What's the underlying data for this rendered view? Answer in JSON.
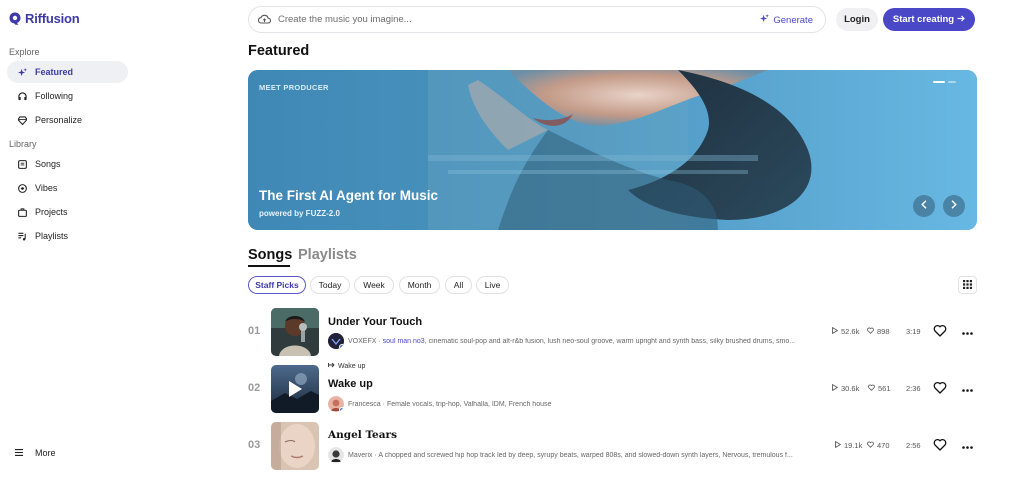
{
  "app": {
    "name": "Riffusion"
  },
  "sidebar": {
    "explore_label": "Explore",
    "library_label": "Library",
    "explore_items": [
      {
        "label": "Featured",
        "icon": "sparkle-icon",
        "active": true
      },
      {
        "label": "Following",
        "icon": "headphones-icon",
        "active": false
      },
      {
        "label": "Personalize",
        "icon": "gem-icon",
        "active": false
      }
    ],
    "library_items": [
      {
        "label": "Songs",
        "icon": "music-box-icon"
      },
      {
        "label": "Vibes",
        "icon": "vibes-icon"
      },
      {
        "label": "Projects",
        "icon": "briefcase-icon"
      },
      {
        "label": "Playlists",
        "icon": "playlist-icon"
      }
    ],
    "more_label": "More"
  },
  "topbar": {
    "search_placeholder": "Create the music you imagine...",
    "generate_label": "Generate",
    "login_label": "Login",
    "start_label": "Start creating"
  },
  "featured": {
    "heading": "Featured",
    "banner": {
      "eyebrow": "MEET PRODUCER",
      "title": "The First AI Agent for Music",
      "subtitle": "powered by FUZZ-2.0",
      "page_count": 2,
      "active_page": 1
    }
  },
  "tabs": [
    {
      "label": "Songs",
      "active": true
    },
    {
      "label": "Playlists",
      "active": false
    }
  ],
  "filters": [
    {
      "label": "Staff Picks",
      "active": true
    },
    {
      "label": "Today",
      "active": false
    },
    {
      "label": "Week",
      "active": false
    },
    {
      "label": "Month",
      "active": false
    },
    {
      "label": "All",
      "active": false
    },
    {
      "label": "Live",
      "active": false
    }
  ],
  "songs": [
    {
      "rank": "01",
      "title": "Under Your Touch",
      "artist": "VOXEFX",
      "highlight": "soul man no3",
      "description": "cinematic soul-pop and alt-r&b fusion, lush neo-soul groove, warm upright and synth bass, silky brushed drums, smo...",
      "plays": "52.6k",
      "likes": "898",
      "duration": "3:19"
    },
    {
      "rank": "02",
      "tag": "Wake up",
      "title": "Wake up",
      "artist": "Francesca",
      "description": "Female vocals, trip-hop, Valhalla, IDM, French house",
      "plays": "30.6k",
      "likes": "561",
      "duration": "2:36"
    },
    {
      "rank": "03",
      "title": "Angel Tears",
      "artist": "Maverix",
      "description": "A chopped and screwed hip hop track led by deep, syrupy beats, warped 808s, and slowed-down synth layers, Nervous, tremulous f...",
      "plays": "19.1k",
      "likes": "470",
      "duration": "2:56"
    }
  ],
  "colors": {
    "brand": "#4b48c8",
    "banner_blue": "#5aa4cc"
  }
}
